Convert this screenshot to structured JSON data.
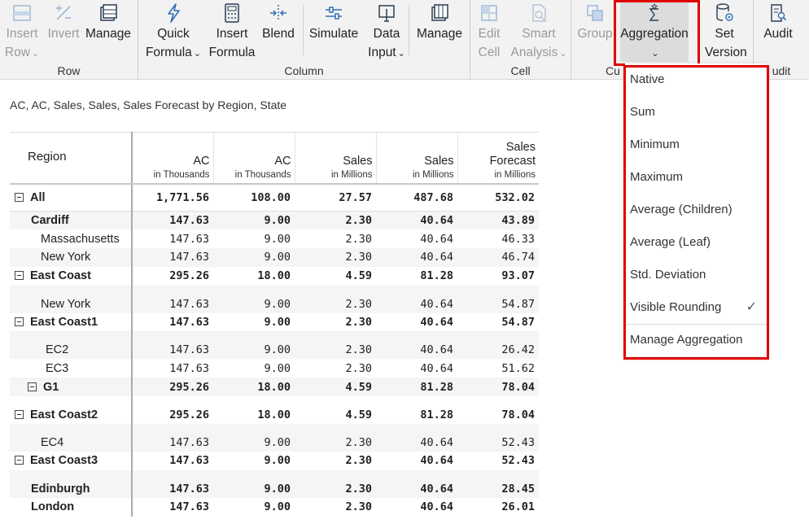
{
  "ribbon": {
    "groups": {
      "row": "Row",
      "column": "Column",
      "cell": "Cell",
      "cu": "Cu",
      "audit": "udit"
    },
    "buttons": {
      "insert_row": [
        "Insert",
        "Row"
      ],
      "invert": [
        "Invert"
      ],
      "manage_row": [
        "Manage"
      ],
      "quick_formula": [
        "Quick",
        "Formula"
      ],
      "insert_formula": [
        "Insert",
        "Formula"
      ],
      "blend": [
        "Blend"
      ],
      "simulate": [
        "Simulate"
      ],
      "data_input": [
        "Data",
        "Input"
      ],
      "manage_col": [
        "Manage"
      ],
      "edit_cell": [
        "Edit",
        "Cell"
      ],
      "smart_analysis": [
        "Smart",
        "Analysis"
      ],
      "group": [
        "Group"
      ],
      "aggregation": [
        "Aggregation"
      ],
      "set_version": [
        "Set",
        "Version"
      ],
      "audit": [
        "Audit"
      ]
    }
  },
  "subtitle": "AC, AC, Sales, Sales, Sales Forecast by Region, State",
  "table": {
    "region_header": "Region",
    "columns": [
      {
        "name": [
          "AC"
        ],
        "unit": "in Thousands"
      },
      {
        "name": [
          "AC"
        ],
        "unit": "in Thousands"
      },
      {
        "name": [
          "Sales"
        ],
        "unit": "in Millions"
      },
      {
        "name": [
          "Sales"
        ],
        "unit": "in Millions"
      },
      {
        "name": [
          "Sales",
          "Forecast"
        ],
        "unit": "in Millions"
      }
    ],
    "rows": [
      {
        "label": "All",
        "values": [
          "1,771.56",
          "108.00",
          "27.57",
          "487.68",
          "532.02"
        ]
      },
      {
        "label": "Cardiff",
        "values": [
          "147.63",
          "9.00",
          "2.30",
          "40.64",
          "43.89"
        ]
      },
      {
        "label": "Massachusetts",
        "values": [
          "147.63",
          "9.00",
          "2.30",
          "40.64",
          "46.33"
        ]
      },
      {
        "label": "New York",
        "values": [
          "147.63",
          "9.00",
          "2.30",
          "40.64",
          "46.74"
        ]
      },
      {
        "label": "East Coast",
        "values": [
          "295.26",
          "18.00",
          "4.59",
          "81.28",
          "93.07"
        ]
      },
      {
        "label": "New York",
        "values": [
          "147.63",
          "9.00",
          "2.30",
          "40.64",
          "54.87"
        ]
      },
      {
        "label": "East Coast1",
        "values": [
          "147.63",
          "9.00",
          "2.30",
          "40.64",
          "54.87"
        ]
      },
      {
        "label": "EC2",
        "values": [
          "147.63",
          "9.00",
          "2.30",
          "40.64",
          "26.42"
        ]
      },
      {
        "label": "EC3",
        "values": [
          "147.63",
          "9.00",
          "2.30",
          "40.64",
          "51.62"
        ]
      },
      {
        "label": "G1",
        "values": [
          "295.26",
          "18.00",
          "4.59",
          "81.28",
          "78.04"
        ]
      },
      {
        "label": "East Coast2",
        "values": [
          "295.26",
          "18.00",
          "4.59",
          "81.28",
          "78.04"
        ]
      },
      {
        "label": "EC4",
        "values": [
          "147.63",
          "9.00",
          "2.30",
          "40.64",
          "52.43"
        ]
      },
      {
        "label": "East Coast3",
        "values": [
          "147.63",
          "9.00",
          "2.30",
          "40.64",
          "52.43"
        ]
      },
      {
        "label": "Edinburgh",
        "values": [
          "147.63",
          "9.00",
          "2.30",
          "40.64",
          "28.45"
        ]
      },
      {
        "label": "London",
        "values": [
          "147.63",
          "9.00",
          "2.30",
          "40.64",
          "26.01"
        ]
      }
    ]
  },
  "menu": {
    "items": [
      "Native",
      "Sum",
      "Minimum",
      "Maximum",
      "Average (Children)",
      "Average (Leaf)",
      "Std. Deviation",
      "Visible Rounding",
      "Manage Aggregation"
    ],
    "checked": "Visible Rounding"
  },
  "colors": {
    "highlight": "#e00000",
    "icon_blue": "#2f6fb5"
  },
  "icons": {
    "insert_row": "insert-row-icon",
    "invert": "invert-icon",
    "manage": "manage-rows-icon",
    "quick_formula": "lightning-icon",
    "insert_formula": "calculator-icon",
    "blend": "blend-icon",
    "simulate": "sliders-icon",
    "data_input": "data-input-icon",
    "manage_col": "manage-columns-icon",
    "edit_cell": "edit-cell-icon",
    "smart_analysis": "smart-analysis-icon",
    "group": "group-icon",
    "aggregation": "sigma-icon",
    "set_version": "database-gear-icon",
    "audit": "audit-icon"
  }
}
